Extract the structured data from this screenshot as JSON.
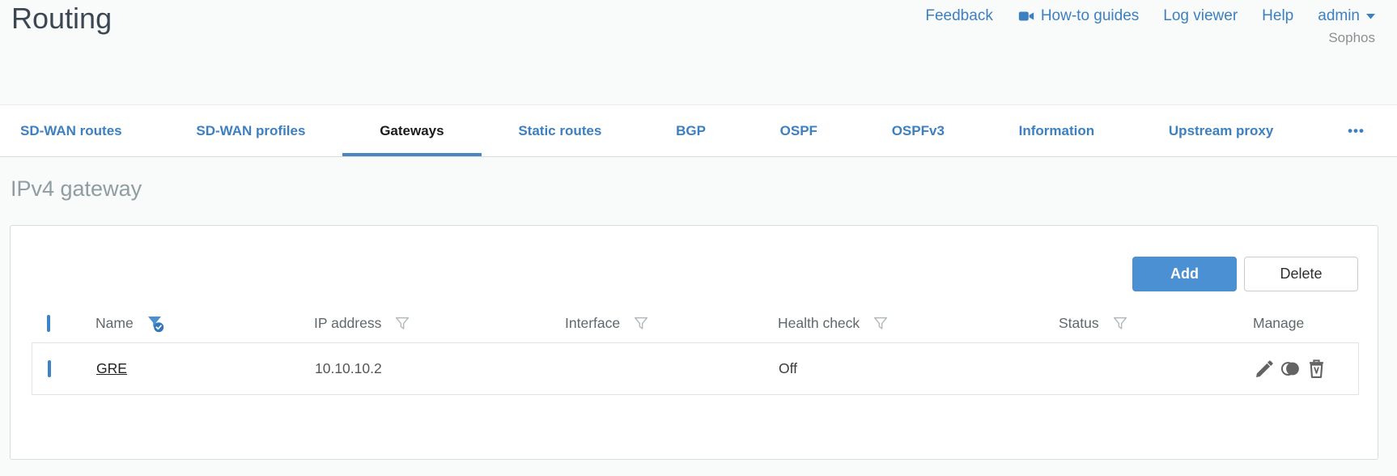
{
  "header": {
    "title": "Routing",
    "brand": "Sophos",
    "nav": {
      "feedback": "Feedback",
      "howto_guides": "How-to guides",
      "log_viewer": "Log viewer",
      "help": "Help",
      "user": "admin"
    }
  },
  "tabs": {
    "items": [
      "SD-WAN routes",
      "SD-WAN profiles",
      "Gateways",
      "Static routes",
      "BGP",
      "OSPF",
      "OSPFv3",
      "Information",
      "Upstream proxy"
    ],
    "active_tab": "Gateways",
    "overflow_label": "•••"
  },
  "section": {
    "title": "IPv4 gateway"
  },
  "toolbar": {
    "add": "Add",
    "delete": "Delete"
  },
  "table": {
    "columns": [
      {
        "label": "Name",
        "filter": "active"
      },
      {
        "label": "IP address",
        "filter": "inactive"
      },
      {
        "label": "Interface",
        "filter": "inactive"
      },
      {
        "label": "Health check",
        "filter": "inactive"
      },
      {
        "label": "Status",
        "filter": "inactive"
      },
      {
        "label": "Manage",
        "filter": "none"
      }
    ],
    "rows": [
      {
        "name": "GRE",
        "ip_address": "10.10.10.2",
        "interface": "",
        "health_check": "Off",
        "status": "green",
        "manage_icons": [
          "edit-icon",
          "toggle-active-icon",
          "delete-icon"
        ]
      }
    ]
  },
  "colors": {
    "link_blue": "#3c80c2",
    "add_button_blue": "#4a90d2",
    "active_tab_underline": "#4a86c2",
    "status_green": "#8dc63f",
    "title_gray": "#8f9da1"
  }
}
